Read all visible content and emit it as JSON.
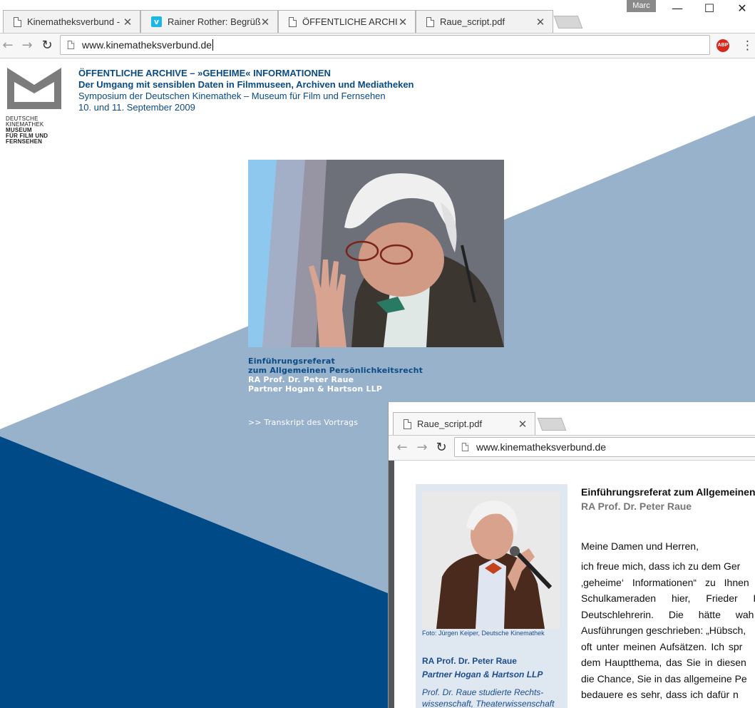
{
  "browser": {
    "profile_name": "Marc",
    "tabs": [
      {
        "title": "Kinematheksverbund - S",
        "icon": "page-icon",
        "active": false
      },
      {
        "title": "Rainer Rother: Begrüßung",
        "icon": "vimeo-icon",
        "active": false
      },
      {
        "title": "ÖFFENTLICHE ARCHIVE –",
        "icon": "page-icon",
        "active": true
      },
      {
        "title": "Raue_script.pdf",
        "icon": "page-icon",
        "active": false
      }
    ],
    "address": "www.kinematheksverbund.de",
    "window_controls": {
      "minimize": "—",
      "maximize": "☐",
      "close": "✕"
    },
    "vimeo_glyph": "v",
    "abp_label": "ABP"
  },
  "site": {
    "logo_lines": [
      "DEUTSCHE",
      "KINEMATHEK",
      "MUSEUM",
      "FÜR FILM UND",
      "FERNSEHEN"
    ],
    "header": {
      "line1": "ÖFFENTLICHE ARCHIVE – »GEHEIME« INFORMATIONEN",
      "line2": "Der Umgang mit sensiblen Daten in Filmmuseen, Archiven und Mediatheken",
      "line3": "Symposium der Deutschen Kinemathek – Museum für Film und Fernsehen",
      "line4": "10. und 11. September 2009"
    },
    "caption": {
      "line1": "Einführungsreferat",
      "line2": "zum Allgemeinen Persönlichkeitsrecht",
      "line3": "RA Prof. Dr. Peter Raue",
      "line4": "Partner Hogan & Hartson LLP"
    },
    "transcript_link": ">> Transkript des Vortrags",
    "colors": {
      "dark_blue": "#004a87",
      "light_blue": "#98b2cc",
      "text_blue": "#0a4b86"
    }
  },
  "pdf_window": {
    "tab_title": "Raue_script.pdf",
    "address": "www.kinematheksverbund.de",
    "sidebar": {
      "photo_credit": "Foto: Jürgen Keiper, Deutsche Kinemathek",
      "name": "RA Prof. Dr. Peter Raue",
      "firm": "Partner Hogan & Hartson LLP",
      "bio_line1": "Prof. Dr. Raue studierte Rechts-",
      "bio_line2": "wissenschaft, Theaterwissenschaft"
    },
    "title": "Einführungsreferat zum Allgemeinen",
    "subtitle": "RA Prof. Dr. Peter Raue",
    "greeting": "Meine Damen und Herren,",
    "body_lines": [
      "ich freue mich, dass ich zu dem Ger",
      "‚geheime‘ Informationen“ zu Ihnen",
      "Schulkameraden hier, Frieder R",
      "Deutschlehrerin. Die hätte wah",
      "Ausführungen geschrieben: „Hübsch,",
      "oft unter meinen Aufsätzen. Ich spr",
      "dem Hauptthema, das Sie in diesen",
      "die Chance, Sie in das allgemeine Pe",
      "bedauere es sehr, dass ich dafür n"
    ]
  }
}
